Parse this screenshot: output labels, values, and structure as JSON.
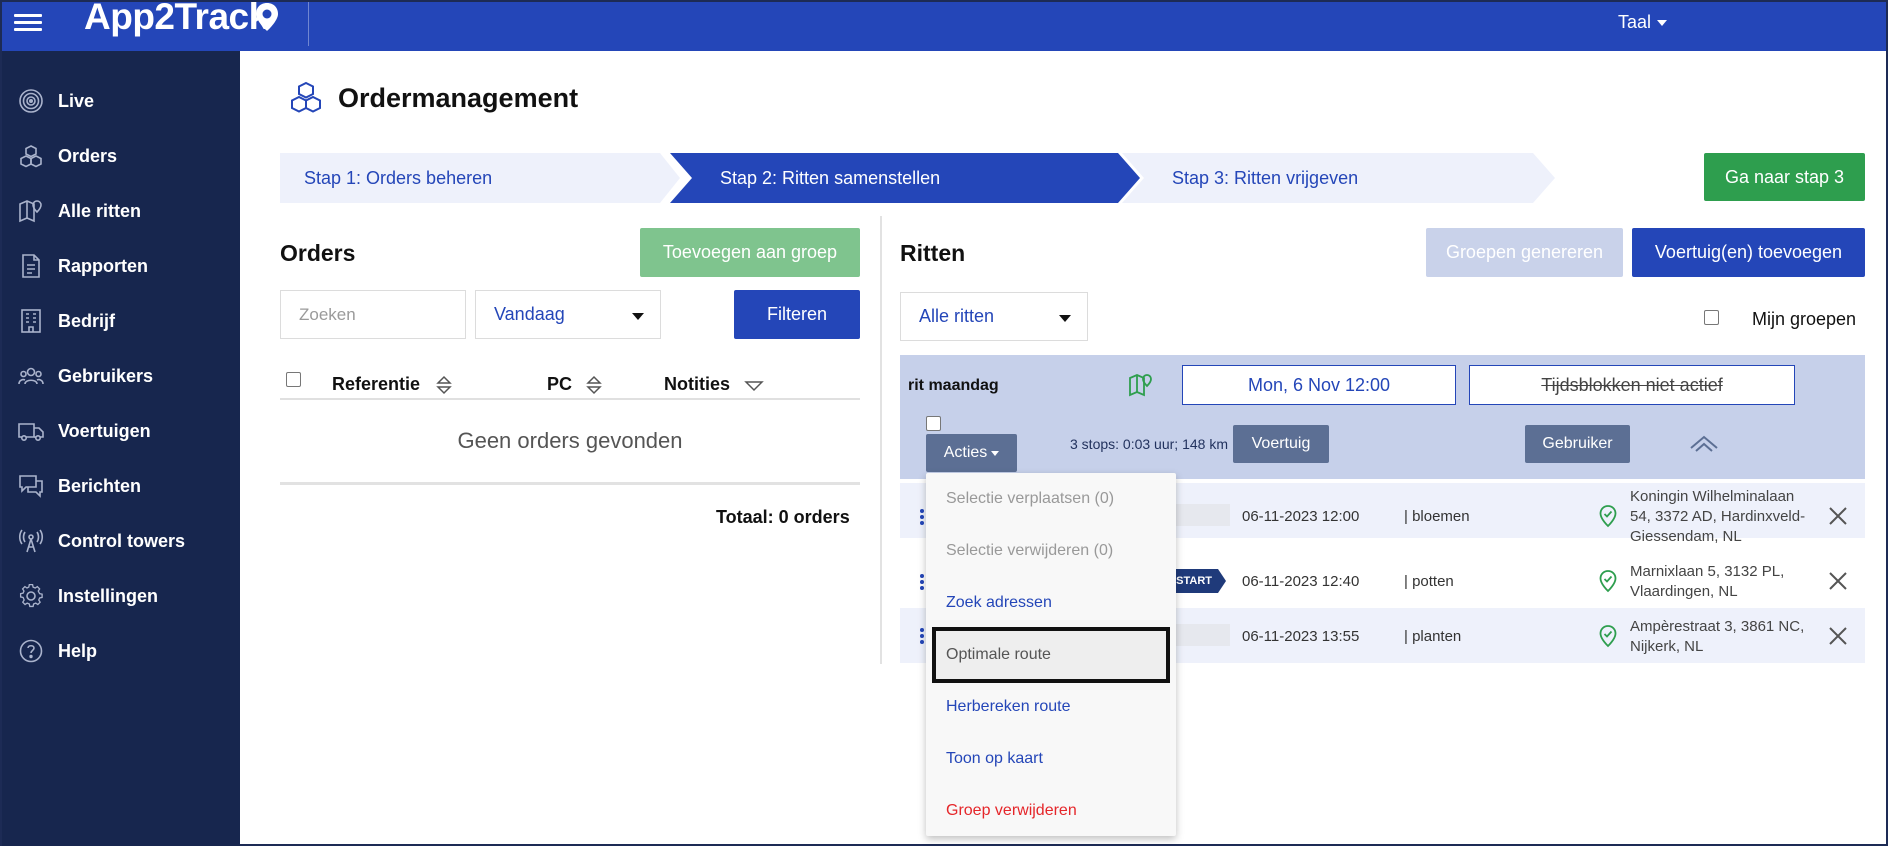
{
  "app": {
    "logo": "App2Track",
    "language_label": "Taal"
  },
  "sidebar": {
    "items": [
      {
        "label": "Live",
        "icon": "live-icon"
      },
      {
        "label": "Orders",
        "icon": "boxes-icon"
      },
      {
        "label": "Alle ritten",
        "icon": "map-pin-icon"
      },
      {
        "label": "Rapporten",
        "icon": "document-icon"
      },
      {
        "label": "Bedrijf",
        "icon": "building-icon"
      },
      {
        "label": "Gebruikers",
        "icon": "users-icon"
      },
      {
        "label": "Voertuigen",
        "icon": "truck-icon"
      },
      {
        "label": "Berichten",
        "icon": "chat-icon"
      },
      {
        "label": "Control towers",
        "icon": "tower-icon"
      },
      {
        "label": "Instellingen",
        "icon": "gear-icon"
      },
      {
        "label": "Help",
        "icon": "help-icon"
      }
    ]
  },
  "page": {
    "title": "Ordermanagement"
  },
  "steps": {
    "step1": "Stap 1: Orders beheren",
    "step2": "Stap 2: Ritten samenstellen",
    "step3": "Stap 3: Ritten vrijgeven",
    "next_button": "Ga naar stap 3"
  },
  "orders": {
    "title": "Orders",
    "add_to_group_button": "Toevoegen aan groep",
    "search_placeholder": "Zoeken",
    "date_filter": "Vandaag",
    "filter_button": "Filteren",
    "columns": [
      "Referentie",
      "PC",
      "Notities"
    ],
    "empty_message": "Geen orders gevonden",
    "total": "Totaal: 0 orders"
  },
  "ritten": {
    "title": "Ritten",
    "generate_groups_button": "Groepen genereren",
    "add_vehicles_button": "Voertuig(en) toevoegen",
    "filter": "Alle ritten",
    "my_groups_label": "Mijn groepen",
    "group": {
      "name": "rit maandag",
      "date": "Mon, 6 Nov 12:00",
      "timeblocks": "Tijdsblokken niet actief",
      "actions_button": "Acties",
      "stops_info": "3 stops: 0:03 uur; 148 km",
      "vehicle_button": "Voertuig",
      "user_button": "Gebruiker",
      "orders": [
        {
          "datetime": "06-11-2023 12:00",
          "item": "| bloemen",
          "address": "Koningin Wilhelminalaan 54, 3372 AD, Hardinxveld-Giessendam, NL",
          "tag": ""
        },
        {
          "datetime": "06-11-2023 12:40",
          "item": "| potten",
          "address": "Marnixlaan 5, 3132 PL, Vlaardingen, NL",
          "tag": "START"
        },
        {
          "datetime": "06-11-2023 13:55",
          "item": "| planten",
          "address": "Ampèrestraat 3, 3861 NC, Nijkerk, NL",
          "tag": ""
        }
      ]
    }
  },
  "actions_menu": {
    "items": [
      {
        "label": "Selectie verplaatsen (0)",
        "state": "disabled"
      },
      {
        "label": "Selectie verwijderen (0)",
        "state": "disabled"
      },
      {
        "label": "Zoek adressen",
        "state": "link"
      },
      {
        "label": "Optimale route",
        "state": "focused"
      },
      {
        "label": "Herbereken route",
        "state": "link"
      },
      {
        "label": "Toon op kaart",
        "state": "link"
      },
      {
        "label": "Groep verwijderen",
        "state": "danger"
      }
    ]
  },
  "colors": {
    "brand_blue": "#2446b8",
    "sidebar": "#17264e",
    "success_green": "#2e9e4e",
    "danger_red": "#e5262a"
  }
}
